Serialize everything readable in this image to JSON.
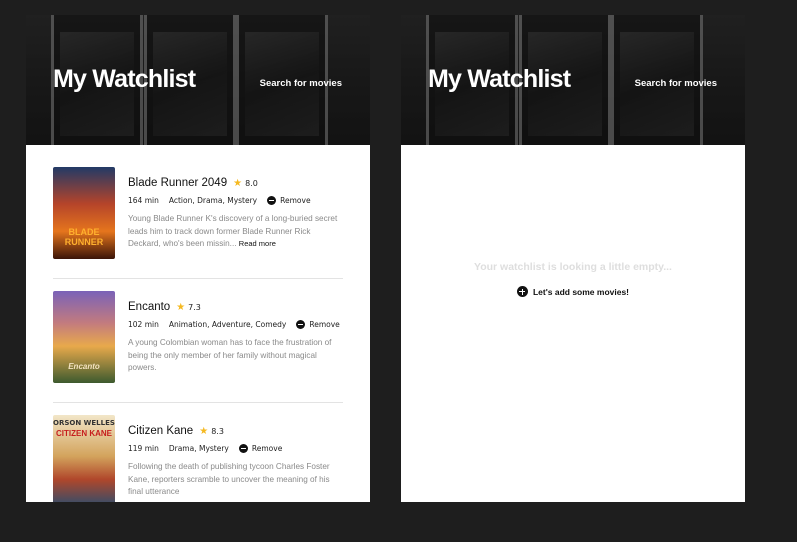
{
  "watchlist_page": {
    "title": "My Watchlist",
    "search_link": "Search for movies",
    "movies": [
      {
        "title": "Blade Runner 2049",
        "rating": "8.0",
        "runtime": "164 min",
        "genres": "Action, Drama, Mystery",
        "remove_label": "Remove",
        "plot": "Young Blade Runner K's discovery of a long-buried secret leads him to track down former Blade Runner Rick Deckard, who's been missin...",
        "read_more": "Read more",
        "poster_text": "BLADE RUNNER"
      },
      {
        "title": "Encanto",
        "rating": "7.3",
        "runtime": "102 min",
        "genres": "Animation, Adventure, Comedy",
        "remove_label": "Remove",
        "plot": "A young Colombian woman has to face the frustration of being the only member of her family without magical powers.",
        "poster_text": "Encanto"
      },
      {
        "title": "Citizen Kane",
        "rating": "8.3",
        "runtime": "119 min",
        "genres": "Drama, Mystery",
        "remove_label": "Remove",
        "plot": "Following the death of publishing tycoon Charles Foster Kane, reporters scramble to uncover the meaning of his final utterance",
        "poster_name": "ORSON WELLES",
        "poster_text": "CITIZEN KANE"
      }
    ]
  },
  "empty_page": {
    "title": "My Watchlist",
    "search_link": "Search for movies",
    "empty_message": "Your watchlist is looking a little empty...",
    "add_label": "Let's add some movies!"
  },
  "colors": {
    "background": "#1e1e1e",
    "star": "#f5b921",
    "card": "#ffffff"
  }
}
